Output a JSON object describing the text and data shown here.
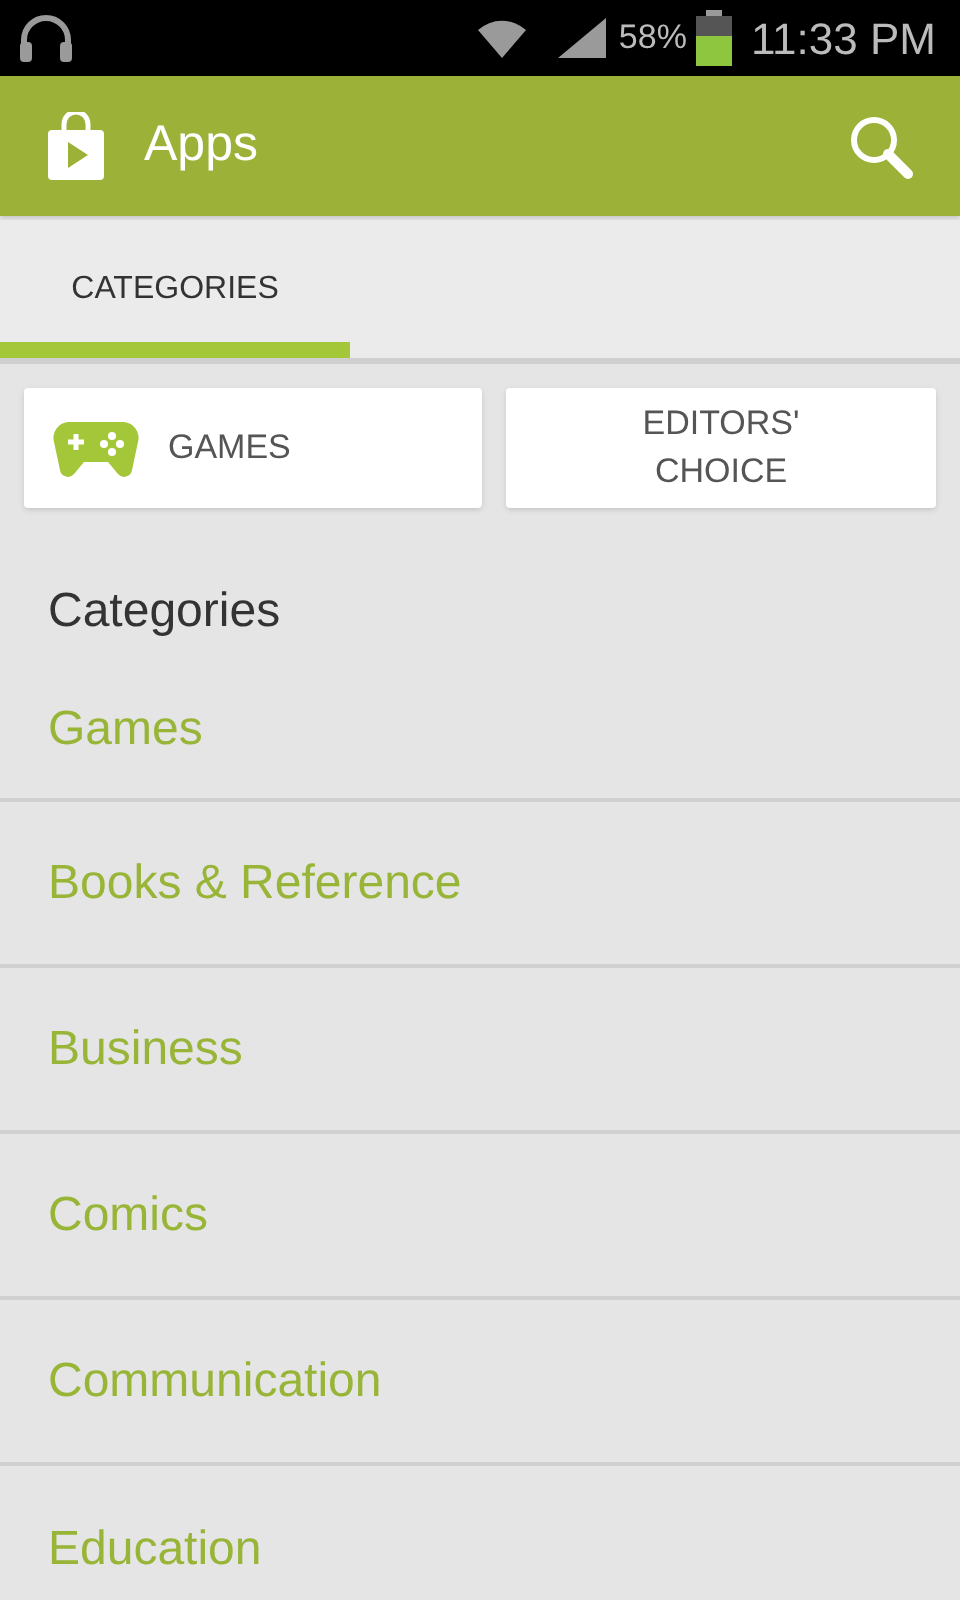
{
  "status_bar": {
    "battery": "58%",
    "time": "11:33 PM"
  },
  "header": {
    "title": "Apps"
  },
  "tabs": [
    {
      "label": "CATEGORIES",
      "selected": true
    }
  ],
  "shortcuts": [
    {
      "label": "GAMES",
      "kind": "games"
    },
    {
      "label": "EDITORS' CHOICE",
      "kind": "plain"
    }
  ],
  "section_title": "Categories",
  "categories": [
    "Games",
    "Books & Reference",
    "Business",
    "Comics",
    "Communication",
    "Education"
  ]
}
